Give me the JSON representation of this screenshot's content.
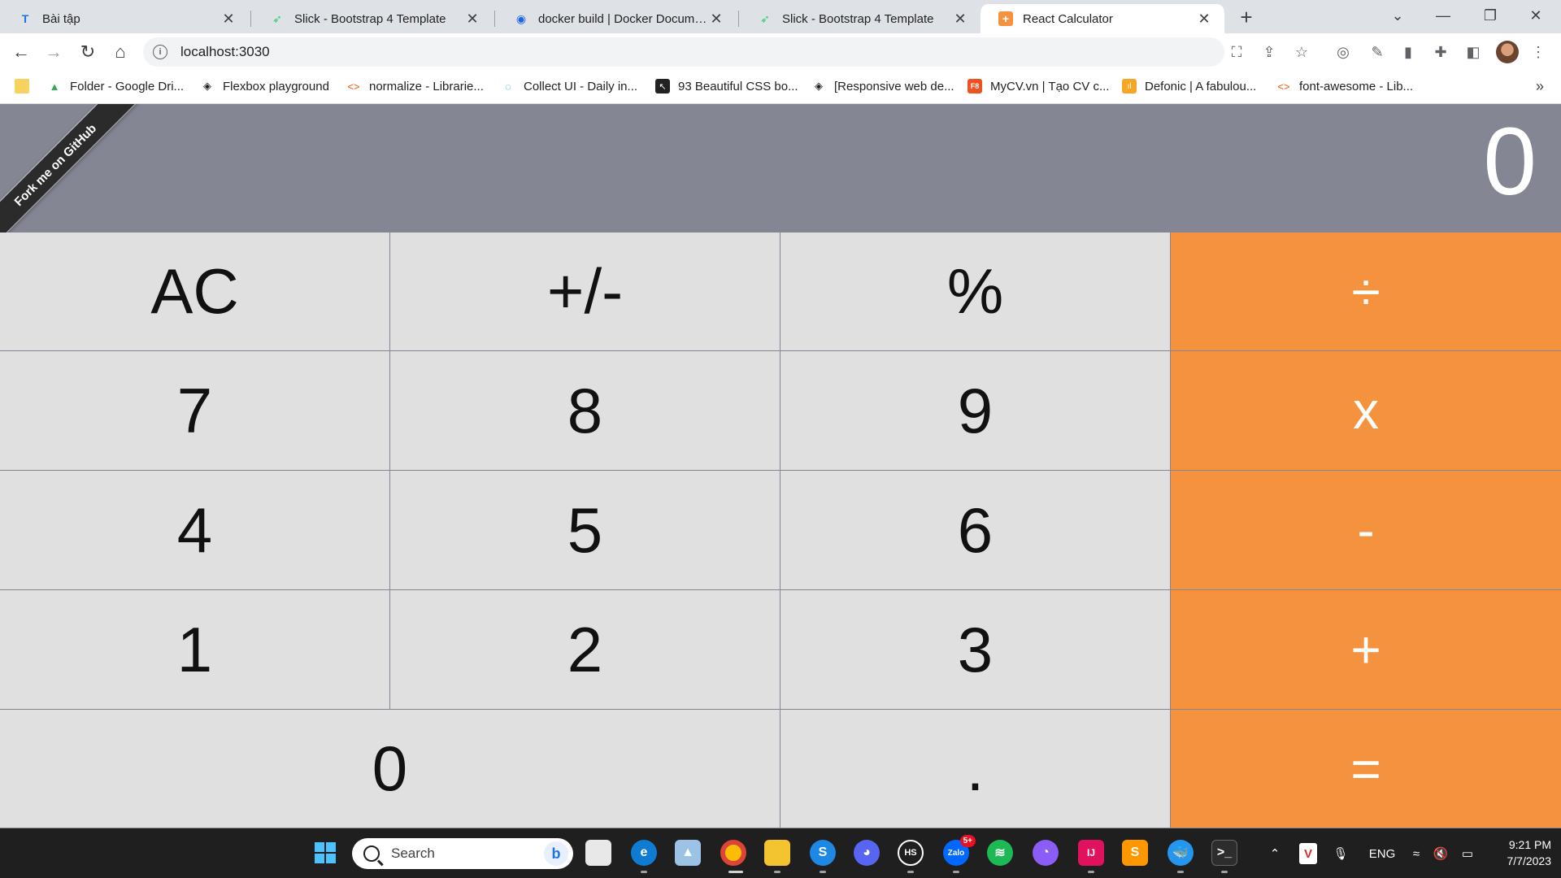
{
  "browser": {
    "tabs": [
      {
        "title": "Bài tập",
        "icon": "T",
        "icon_color": "#1a73e8",
        "active": false
      },
      {
        "title": "Slick - Bootstrap 4 Template",
        "icon": "➶",
        "icon_color": "#2ecc71",
        "active": false
      },
      {
        "title": "docker build | Docker Documentation",
        "icon": "◉",
        "icon_color": "#1d63ed",
        "active": false
      },
      {
        "title": "Slick - Bootstrap 4 Template",
        "icon": "➶",
        "icon_color": "#2ecc71",
        "active": false
      },
      {
        "title": "React Calculator",
        "icon": "+",
        "icon_color": "#f5923e",
        "active": true
      }
    ],
    "new_tab_label": "+",
    "url": "localhost:3030",
    "bookmarks": [
      {
        "label": "",
        "icon": "folder-icon"
      },
      {
        "label": "Folder - Google Dri...",
        "icon": "google-drive-icon"
      },
      {
        "label": "Flexbox playground",
        "icon": "codepen-icon"
      },
      {
        "label": "normalize - Librarie...",
        "icon": "code-icon"
      },
      {
        "label": "Collect UI - Daily in...",
        "icon": "collectui-icon"
      },
      {
        "label": "93 Beautiful CSS bo...",
        "icon": "cursor-icon"
      },
      {
        "label": "[Responsive web de...",
        "icon": "codepen-icon"
      },
      {
        "label": "MyCV.vn | Tạo CV c...",
        "icon": "f8-icon"
      },
      {
        "label": "Defonic | A fabulou...",
        "icon": "defonic-icon"
      },
      {
        "label": "font-awesome - Lib...",
        "icon": "code-icon"
      }
    ]
  },
  "calculator": {
    "display": "0",
    "ribbon": "Fork me on GitHub",
    "keys": [
      {
        "label": "AC",
        "type": "fn"
      },
      {
        "label": "+/-",
        "type": "fn"
      },
      {
        "label": "%",
        "type": "fn"
      },
      {
        "label": "÷",
        "type": "op"
      },
      {
        "label": "7",
        "type": "num"
      },
      {
        "label": "8",
        "type": "num"
      },
      {
        "label": "9",
        "type": "num"
      },
      {
        "label": "x",
        "type": "op"
      },
      {
        "label": "4",
        "type": "num"
      },
      {
        "label": "5",
        "type": "num"
      },
      {
        "label": "6",
        "type": "num"
      },
      {
        "label": "-",
        "type": "op"
      },
      {
        "label": "1",
        "type": "num"
      },
      {
        "label": "2",
        "type": "num"
      },
      {
        "label": "3",
        "type": "num"
      },
      {
        "label": "+",
        "type": "op"
      },
      {
        "label": "0",
        "type": "num",
        "wide": true
      },
      {
        "label": ".",
        "type": "num"
      },
      {
        "label": "=",
        "type": "op"
      }
    ],
    "colors": {
      "display_bg": "#858694",
      "key_bg": "#e0e0e0",
      "operator_bg": "#f5923e"
    }
  },
  "taskbar": {
    "search_placeholder": "Search",
    "language": "ENG",
    "time": "9:21 PM",
    "date": "7/7/2023",
    "zalo_badge": "5+"
  }
}
